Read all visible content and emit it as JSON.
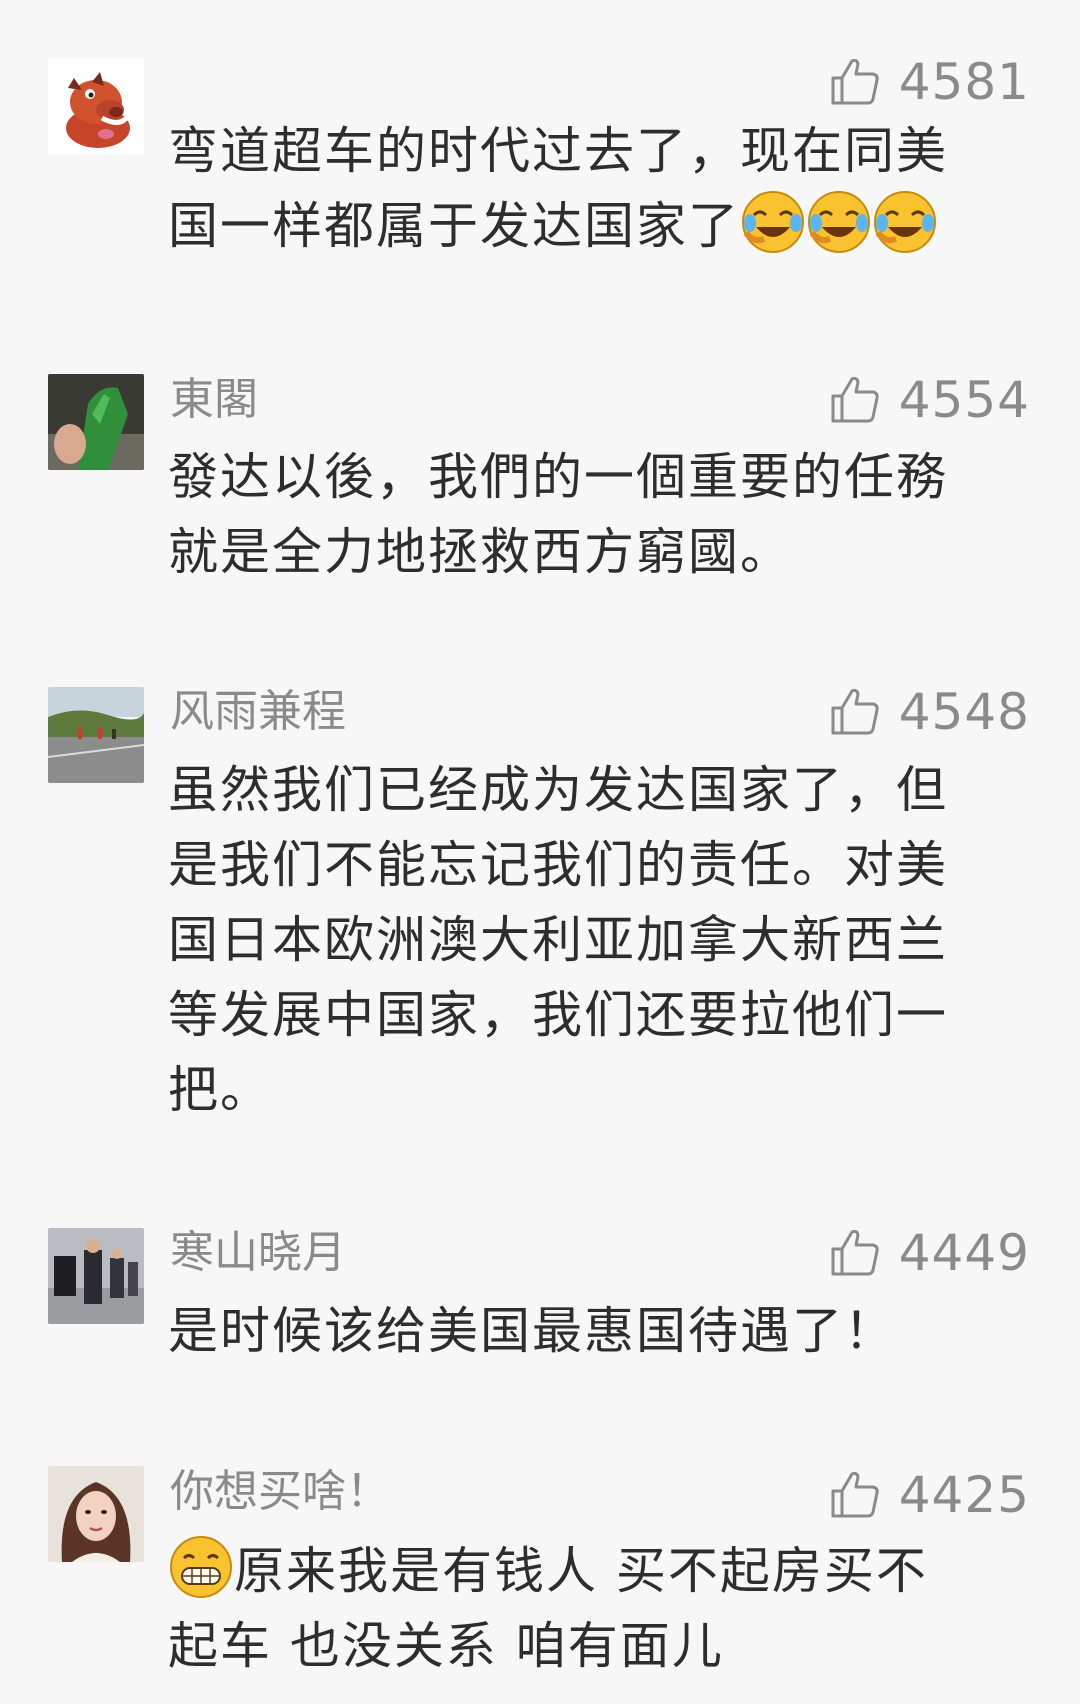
{
  "comments": [
    {
      "username": "",
      "likes": "4581",
      "avatar_icon": "warthog-avatar",
      "lines": [
        "弯道超车的时代过去了，现在同美",
        "国一样都属于发达国家了"
      ],
      "line2_emojis": [
        "laugh-cry-emoji",
        "laugh-cry-emoji",
        "laugh-cry-emoji"
      ]
    },
    {
      "username": "東閣",
      "likes": "4554",
      "avatar_icon": "green-bottle-avatar",
      "lines": [
        "發达以後，我們的一個重要的任務",
        "就是全力地拯救西方窮國。"
      ]
    },
    {
      "username": "风雨兼程",
      "likes": "4548",
      "avatar_icon": "road-landscape-avatar",
      "lines": [
        "虽然我们已经成为发达国家了，但",
        "是我们不能忘记我们的责任。对美",
        "国日本欧洲澳大利亚加拿大新西兰",
        "等发展中国家，我们还要拉他们一",
        "把。"
      ]
    },
    {
      "username": "寒山晓月",
      "likes": "4449",
      "avatar_icon": "people-walking-avatar",
      "lines": [
        "是时候该给美国最惠国待遇了！"
      ]
    },
    {
      "username": "你想买啥！",
      "likes": "4425",
      "avatar_icon": "woman-portrait-avatar",
      "line1_emoji": "grin-emoji",
      "lines": [
        "原来我是有钱人  买不起房买不",
        "起车 也没关系 咱有面儿"
      ]
    }
  ],
  "like_icon": "thumbs-up-icon"
}
